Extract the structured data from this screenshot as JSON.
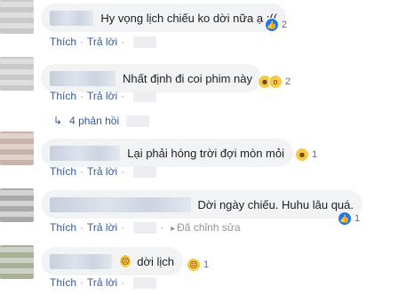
{
  "actions": {
    "like": "Thích",
    "reply": "Trả lời",
    "separator": "·"
  },
  "comments": [
    {
      "text": "Hy vọng lịch chiếu ko dời nữa ạ :((",
      "reactions": [
        "like-icon"
      ],
      "count": "2"
    },
    {
      "text": "Nhất định đi coi phim này",
      "reactions": [
        "haha-icon",
        "wow-icon"
      ],
      "count": "2"
    },
    {
      "text": "Lại phải hóng trời đợi mòn mỏi",
      "reactions": [
        "haha-icon"
      ],
      "count": "1"
    },
    {
      "text": "Dời ngày chiếu. Huhu lâu quá.",
      "reactions": [
        "like-icon"
      ],
      "count": "1",
      "edited": "Đã chỉnh sửa"
    },
    {
      "text": "dời lịch",
      "reactions": [
        "sad-icon"
      ],
      "count": "1"
    }
  ],
  "replies": {
    "label": "4 phản hồi"
  }
}
